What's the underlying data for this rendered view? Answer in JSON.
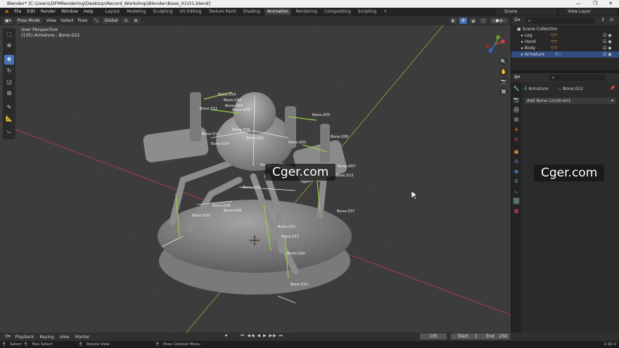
{
  "window": {
    "title": "Blender* [C:\\Users\\DFMRendering\\Desktop\\Record_Workshop\\Blender\\Base_01\\01.blend]",
    "minimize": "—",
    "maximize": "❐",
    "close": "✕"
  },
  "menu": [
    "File",
    "Edit",
    "Render",
    "Window",
    "Help"
  ],
  "workspaces": [
    "Layout",
    "Modeling",
    "Sculpting",
    "UV Editing",
    "Texture Paint",
    "Shading",
    "Animation",
    "Rendering",
    "Compositing",
    "Scripting"
  ],
  "workspace_add": "+",
  "active_workspace": "Animation",
  "scene": "Scene",
  "view_layer": "View Layer",
  "viewport_header": {
    "mode": "Pose Mode",
    "menus": [
      "View",
      "Select",
      "Pose"
    ],
    "orientation": "Global"
  },
  "viewport": {
    "perspective": "User Perspective",
    "object_info": "(135) Armature : Bone.022",
    "bones": [
      "Bone.054",
      "Bone.056",
      "Bone.055",
      "Bone.009",
      "Bone.011",
      "Bone.005",
      "Bone.008",
      "Bone.012",
      "Bone.002",
      "Bone.003",
      "Bone.006",
      "Bone.014",
      "Bone.007",
      "Bone.013",
      "Bone",
      "Bone.015",
      "Bone.030",
      "Bone.049",
      "Bone.028",
      "Bone.037",
      "Bone.031",
      "Bone.017",
      "Bone.020",
      "Bone.021"
    ]
  },
  "watermark": "Cger.com",
  "outliner": {
    "collection": "Scene Collection",
    "items": [
      "Leg",
      "Hand",
      "Body",
      "Armature"
    ]
  },
  "properties": {
    "object": "Armature",
    "bone": "Bone.022",
    "add_constraint": "Add Bone Constraint"
  },
  "timeline": {
    "menus": [
      "Playback",
      "Keying",
      "View",
      "Marker"
    ],
    "current_frame": "135",
    "start_label": "Start",
    "start": "1",
    "end_label": "End",
    "end": "250"
  },
  "status": {
    "select": "Select",
    "box_select": "Box Select",
    "rotate_view": "Rotate View",
    "context_menu": "Pose Context Menu",
    "version": "2.92.0"
  },
  "colors": {
    "accent": "#4772b3",
    "selected_row": "#334d80",
    "x_axis": "#b83a4a",
    "y_axis": "#8aa13a"
  }
}
